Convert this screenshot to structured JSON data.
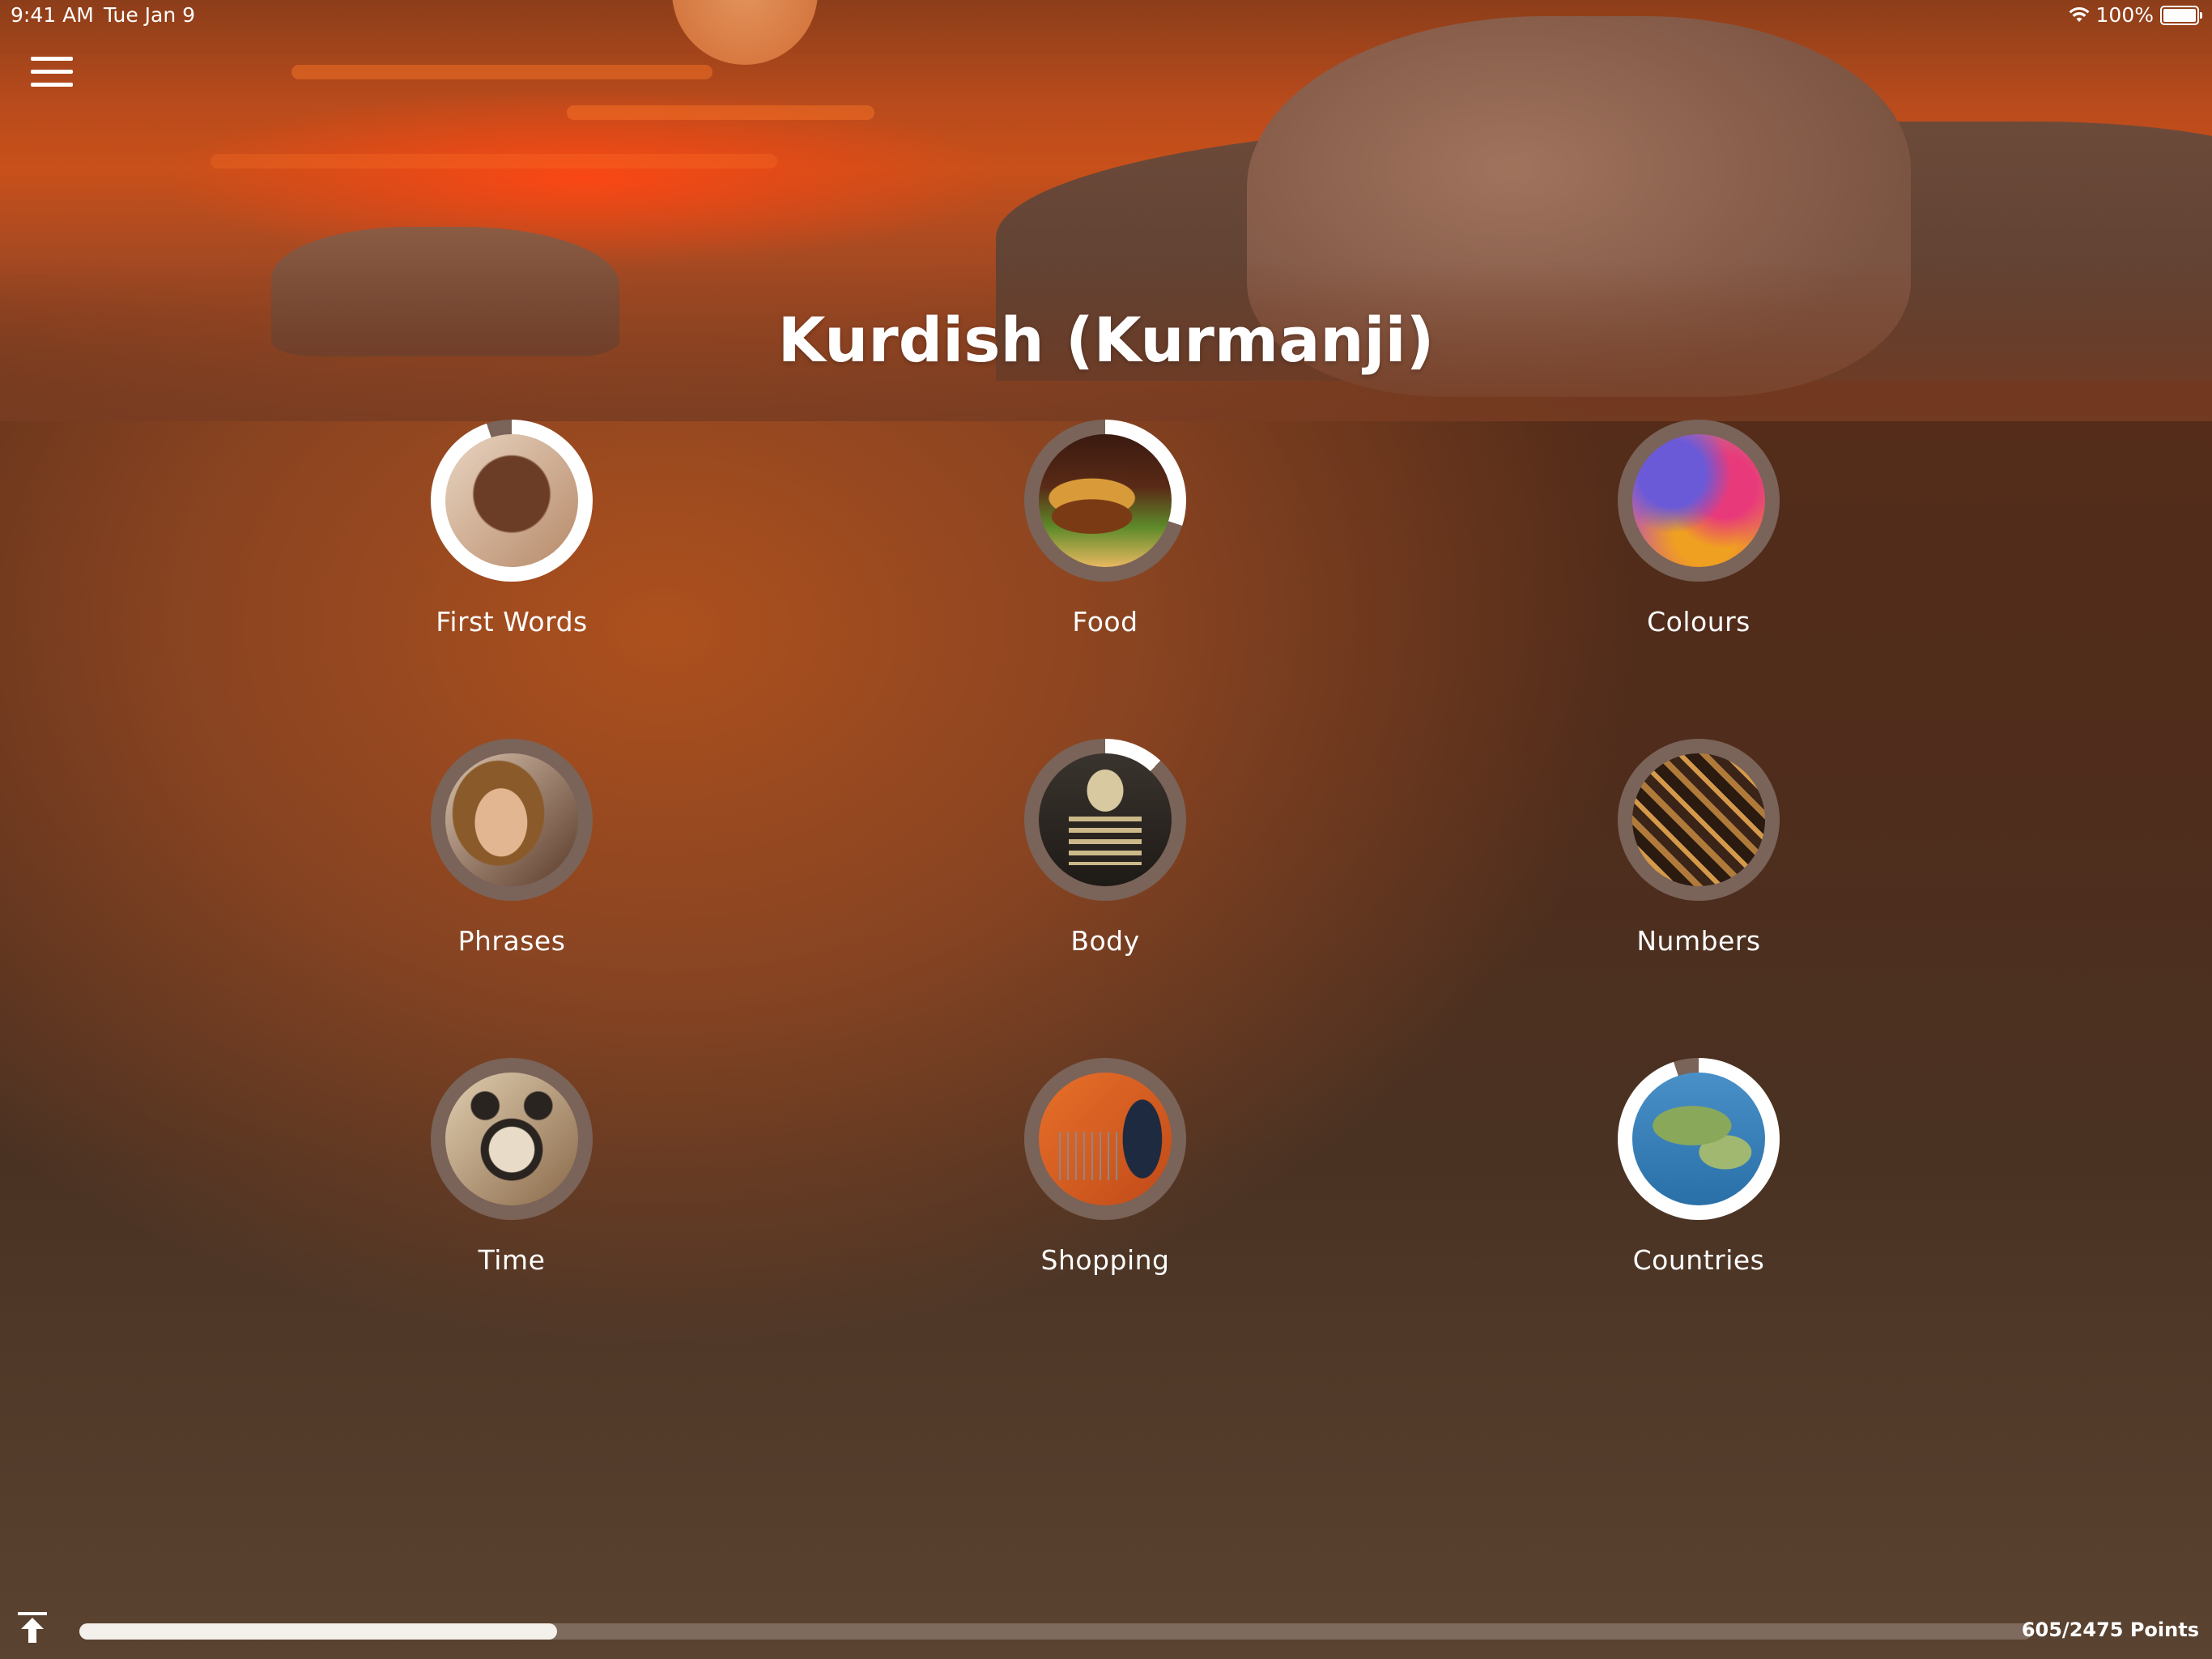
{
  "status": {
    "time": "9:41 AM",
    "date": "Tue Jan 9",
    "battery": "100%"
  },
  "title": "Kurdish (Kurmanji)",
  "categories": [
    {
      "label": "First Words",
      "progress": 0.95,
      "theme": "child-face"
    },
    {
      "label": "Food",
      "progress": 0.3,
      "theme": "burger"
    },
    {
      "label": "Colours",
      "progress": 0.0,
      "theme": "color-powder"
    },
    {
      "label": "Phrases",
      "progress": 0.0,
      "theme": "smiling-woman"
    },
    {
      "label": "Body",
      "progress": 0.12,
      "theme": "skeleton"
    },
    {
      "label": "Numbers",
      "progress": 0.0,
      "theme": "wooden-numbers"
    },
    {
      "label": "Time",
      "progress": 0.0,
      "theme": "alarm-clock"
    },
    {
      "label": "Shopping",
      "progress": 0.0,
      "theme": "shopping-cart"
    },
    {
      "label": "Countries",
      "progress": 0.95,
      "theme": "world-map"
    }
  ],
  "footer": {
    "points_label": "605/2475 Points",
    "points": 605,
    "total": 2475
  },
  "colors": {
    "ring_track": "#7a6358",
    "ring_fill": "#ffffff",
    "accent_orange": "#c8501a"
  }
}
